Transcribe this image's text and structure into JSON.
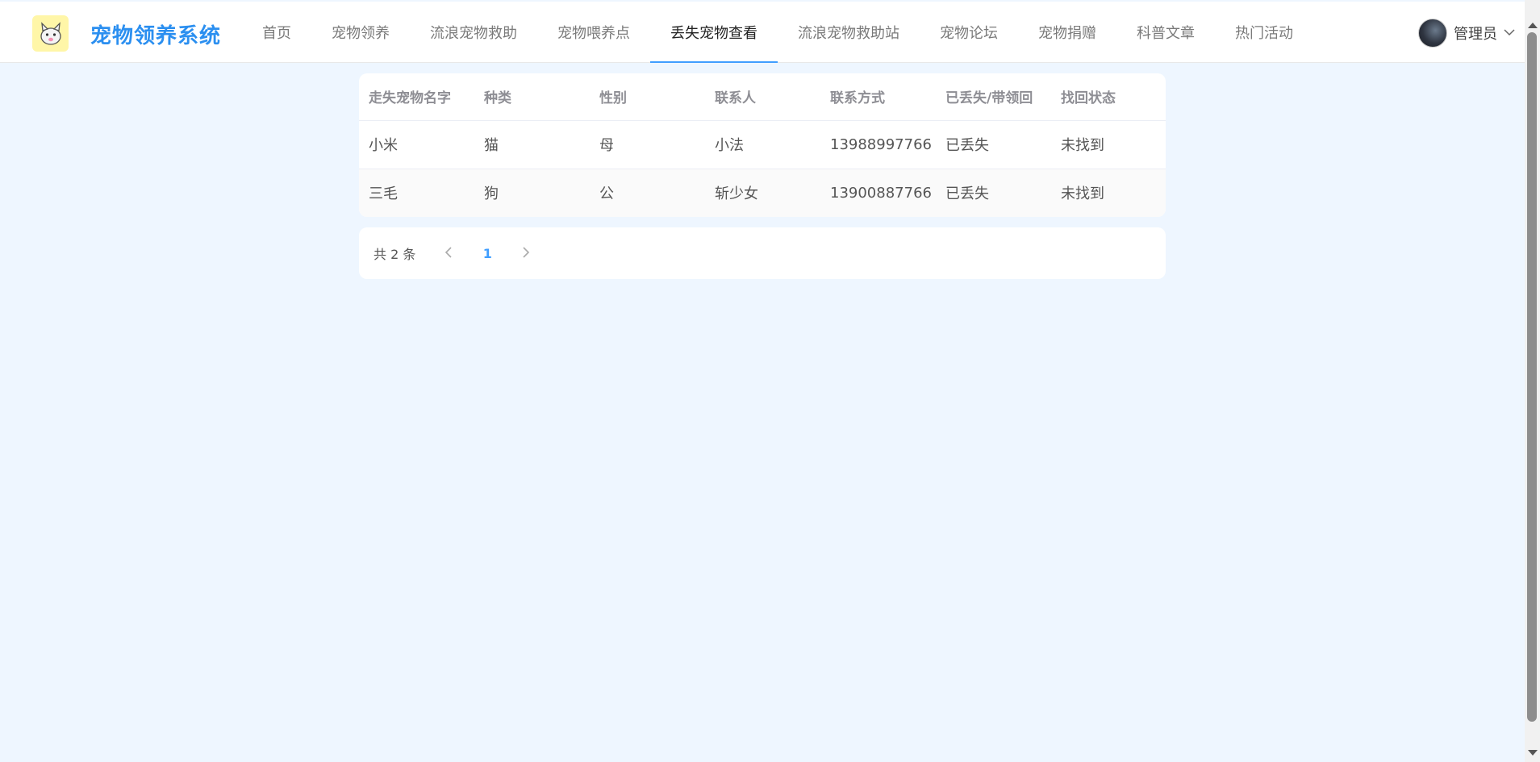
{
  "app": {
    "brand": "宠物领养系统",
    "logo_icon": "cat-logo-icon"
  },
  "nav": {
    "items": [
      {
        "label": "首页",
        "active": false
      },
      {
        "label": "宠物领养",
        "active": false
      },
      {
        "label": "流浪宠物救助",
        "active": false
      },
      {
        "label": "宠物喂养点",
        "active": false
      },
      {
        "label": "丢失宠物查看",
        "active": true
      },
      {
        "label": "流浪宠物救助站",
        "active": false
      },
      {
        "label": "宠物论坛",
        "active": false
      },
      {
        "label": "宠物捐赠",
        "active": false
      },
      {
        "label": "科普文章",
        "active": false
      },
      {
        "label": "热门活动",
        "active": false
      }
    ]
  },
  "user": {
    "name": "管理员",
    "dropdown_icon": "chevron-down-icon"
  },
  "table": {
    "columns": [
      "走失宠物名字",
      "种类",
      "性别",
      "联系人",
      "联系方式",
      "已丢失/带领回",
      "找回状态"
    ],
    "rows": [
      [
        "小米",
        "猫",
        "母",
        "小法",
        "13988997766",
        "已丢失",
        "未找到"
      ],
      [
        "三毛",
        "狗",
        "公",
        "斩少女",
        "13900887766",
        "已丢失",
        "未找到"
      ]
    ]
  },
  "pagination": {
    "total_text": "共 2 条",
    "current_page": "1",
    "prev_icon": "chevron-left-icon",
    "next_icon": "chevron-right-icon"
  },
  "colors": {
    "accent": "#409eff",
    "brand": "#2b8ff0",
    "page_bg": "#eef6ff"
  }
}
